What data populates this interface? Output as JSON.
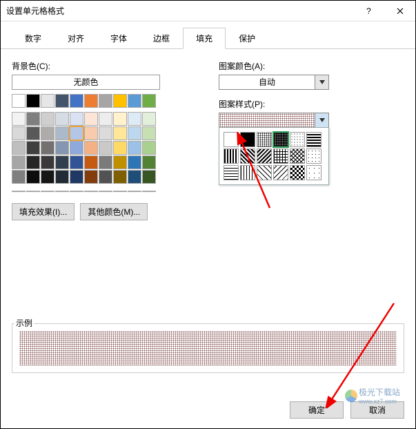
{
  "window": {
    "title": "设置单元格格式"
  },
  "tabs": {
    "items": [
      "数字",
      "对齐",
      "字体",
      "边框",
      "填充",
      "保护"
    ],
    "activeIndex": 4
  },
  "fill": {
    "bgColorLabel": "背景色(C):",
    "noColor": "无颜色",
    "fillEffectsBtn": "填充效果(I)...",
    "moreColorsBtn": "其他颜色(M)...",
    "patternColorLabel": "图案颜色(A):",
    "patternColorAuto": "自动",
    "patternStyleLabel": "图案样式(P):"
  },
  "palette": {
    "row1": [
      "#ffffff",
      "#000000",
      "#e7e6e6",
      "#44546a",
      "#4472c4",
      "#ed7d31",
      "#a5a5a5",
      "#ffc000",
      "#5b9bd5",
      "#70ad47"
    ],
    "grid": [
      [
        "#f2f2f2",
        "#7f7f7f",
        "#d0cece",
        "#d6dce4",
        "#d9e1f2",
        "#fce4d6",
        "#ededed",
        "#fff2cc",
        "#ddebf7",
        "#e2efda"
      ],
      [
        "#d9d9d9",
        "#595959",
        "#aeabab",
        "#acb9ca",
        "#b4c6e7",
        "#f8cbad",
        "#dbdbdb",
        "#ffe699",
        "#bdd7ee",
        "#c6e0b4"
      ],
      [
        "#bfbfbf",
        "#3f3f3f",
        "#757070",
        "#8496b0",
        "#8ea9db",
        "#f4b183",
        "#c9c9c9",
        "#ffd966",
        "#9bc2e6",
        "#a9d08e"
      ],
      [
        "#a6a6a6",
        "#262626",
        "#3a3838",
        "#323f4f",
        "#305496",
        "#c55a11",
        "#7b7b7b",
        "#bf8f00",
        "#2e75b6",
        "#548235"
      ],
      [
        "#7f7f7f",
        "#0d0d0d",
        "#171616",
        "#222a35",
        "#203864",
        "#833c0c",
        "#525252",
        "#7f6000",
        "#1f4e79",
        "#375623"
      ]
    ],
    "standard": [
      "#c00000",
      "#ff0000",
      "#ffc000",
      "#ffff00",
      "#92d050",
      "#00b050",
      "#00b0f0",
      "#0070c0",
      "#002060",
      "#7030a0"
    ],
    "selected": {
      "row": 1,
      "col": 4
    }
  },
  "patterns": {
    "rows": [
      [
        "none",
        "solid",
        "dots50",
        "dots75",
        "dots25",
        "hstripe"
      ],
      [
        "vstripe",
        "diag1",
        "diag2",
        "grid",
        "trellis",
        "dots10"
      ],
      [
        "hstripe2",
        "vstripe2",
        "diag3",
        "diag4",
        "checker",
        "dots5"
      ]
    ],
    "selected": {
      "row": 0,
      "col": 3
    }
  },
  "sample": {
    "label": "示例"
  },
  "footer": {
    "ok": "确定",
    "cancel": "取消"
  },
  "watermark": {
    "text": "极光下载站",
    "url": "www.xz7.com"
  }
}
